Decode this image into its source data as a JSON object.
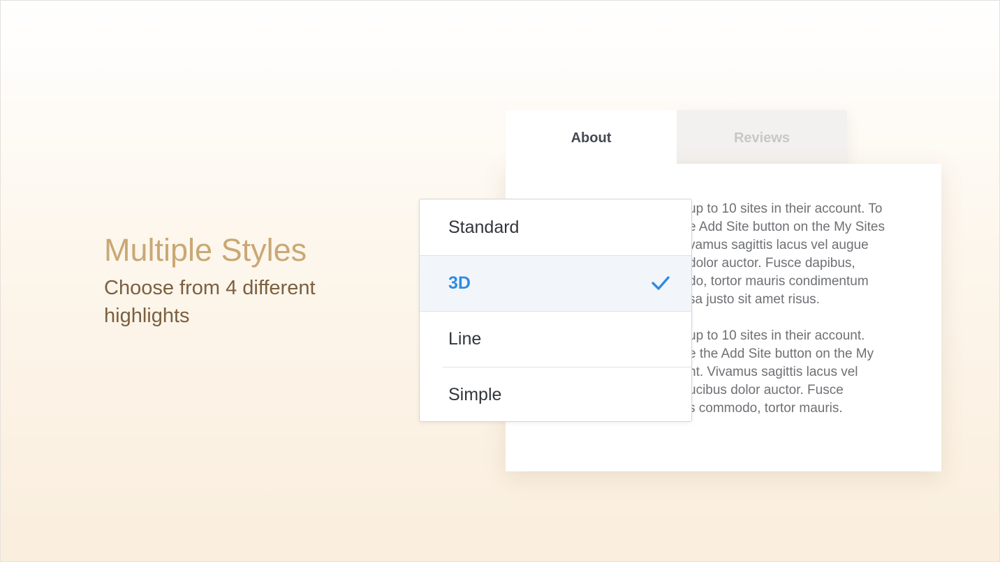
{
  "hero": {
    "title": "Multiple Styles",
    "subtitle": "Choose from 4 different highlights"
  },
  "tabs": [
    {
      "label": "About",
      "active": true
    },
    {
      "label": "Reviews",
      "active": false
    }
  ],
  "content": {
    "paragraph_1": "up to 10 sites in their account. To\ne Add Site button on the My Sites\nvamus sagittis lacus vel augue\ndolor auctor. Fusce dapibus,\ndo, tortor mauris condimentum\nsa justo sit amet risus.",
    "paragraph_2": "up to 10 sites in their account.\ne the Add Site button on the My\nnt. Vivamus sagittis lacus vel\nucibus dolor auctor. Fusce\ns commodo, tortor mauris."
  },
  "dropdown": {
    "options": [
      "Standard",
      "3D",
      "Line",
      "Simple"
    ],
    "selected": "3D",
    "selected_icon": "checkmark-icon"
  },
  "colors": {
    "accent": "#2f8be3",
    "hero_title": "#c9a874",
    "hero_subtitle": "#7b6040"
  }
}
